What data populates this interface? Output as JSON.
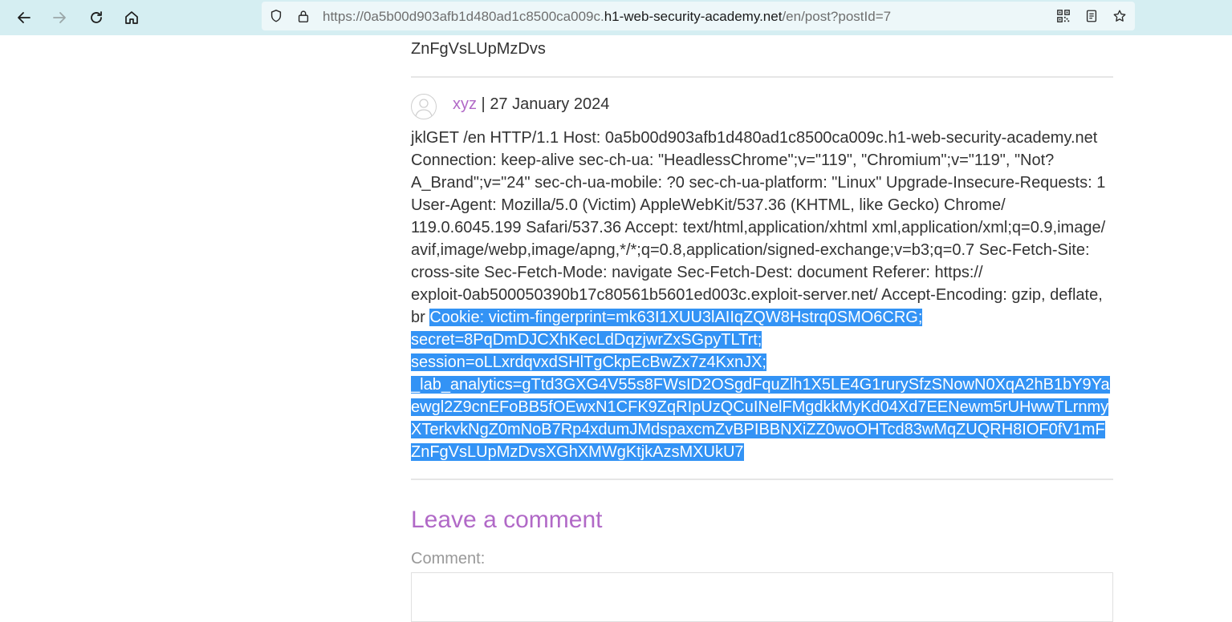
{
  "browser": {
    "url_prefix": "https://0a5b00d903afb1d480ad1c8500ca009c.",
    "url_domain": "h1-web-security-academy.net",
    "url_suffix": "/en/post?postId=7"
  },
  "page": {
    "previous_comment_tail": "ZnFgVsLUpMzDvs",
    "comment": {
      "author": "xyz",
      "separator": " | ",
      "date": "27 January 2024",
      "lines": [
        {
          "plain": "jklGET /en HTTP/1.1 Host: 0a5b00d903afb1d480ad1c8500ca009c.h1-web-security-academy.net",
          "selected": ""
        },
        {
          "plain": "Connection: keep-alive sec-ch-ua: \"HeadlessChrome\";v=\"119\", \"Chromium\";v=\"119\", \"Not?",
          "selected": ""
        },
        {
          "plain": "A_Brand\";v=\"24\" sec-ch-ua-mobile: ?0 sec-ch-ua-platform: \"Linux\" Upgrade-Insecure-Requests: 1",
          "selected": ""
        },
        {
          "plain": "User-Agent: Mozilla/5.0 (Victim) AppleWebKit/537.36 (KHTML, like Gecko) Chrome/",
          "selected": ""
        },
        {
          "plain": "119.0.6045.199 Safari/537.36 Accept: text/html,application/xhtml xml,application/xml;q=0.9,image/",
          "selected": ""
        },
        {
          "plain": "avif,image/webp,image/apng,*/*;q=0.8,application/signed-exchange;v=b3;q=0.7 Sec-Fetch-Site:",
          "selected": ""
        },
        {
          "plain": "cross-site Sec-Fetch-Mode: navigate Sec-Fetch-Dest: document Referer: https://",
          "selected": ""
        },
        {
          "plain": "exploit-0ab500050390b17c80561b5601ed003c.exploit-server.net/ Accept-Encoding: gzip, deflate,",
          "selected": ""
        },
        {
          "plain": "br ",
          "selected": "Cookie: victim-fingerprint=mk63I1XUU3lAIIqZQW8Hstrq0SMO6CRG; "
        },
        {
          "plain": "",
          "selected": "secret=8PqDmDJCXhKecLdDqzjwrZxSGpyTLTrt; "
        },
        {
          "plain": "",
          "selected": "session=oLLxrdqvxdSHlTgCkpEcBwZx7z4KxnJX; "
        },
        {
          "plain": "",
          "selected": "_lab_analytics=gTtd3GXG4V55s8FWsID2OSgdFquZlh1X5LE4G1rurySfzSNowN0XqA2hB1bY9Ya"
        },
        {
          "plain": "",
          "selected": "ewgl2Z9cnEFoBB5fOEwxN1CFK9ZqRIpUzQCuINelFMgdkkMyKd04Xd7EENewm5rUHwwTLrnmy"
        },
        {
          "plain": "",
          "selected": "XTerkvkNgZ0mNoB7Rp4xdumJMdspaxcmZvBPIBBNXiZZ0woOHTcd83wMqZUQRH8IOF0fV1mF"
        },
        {
          "plain": "",
          "selected": "ZnFgVsLUpMzDvsXGhXMWgKtjkAzsMXUkU7"
        }
      ]
    },
    "leave_comment_title": "Leave a comment",
    "comment_label": "Comment:"
  }
}
